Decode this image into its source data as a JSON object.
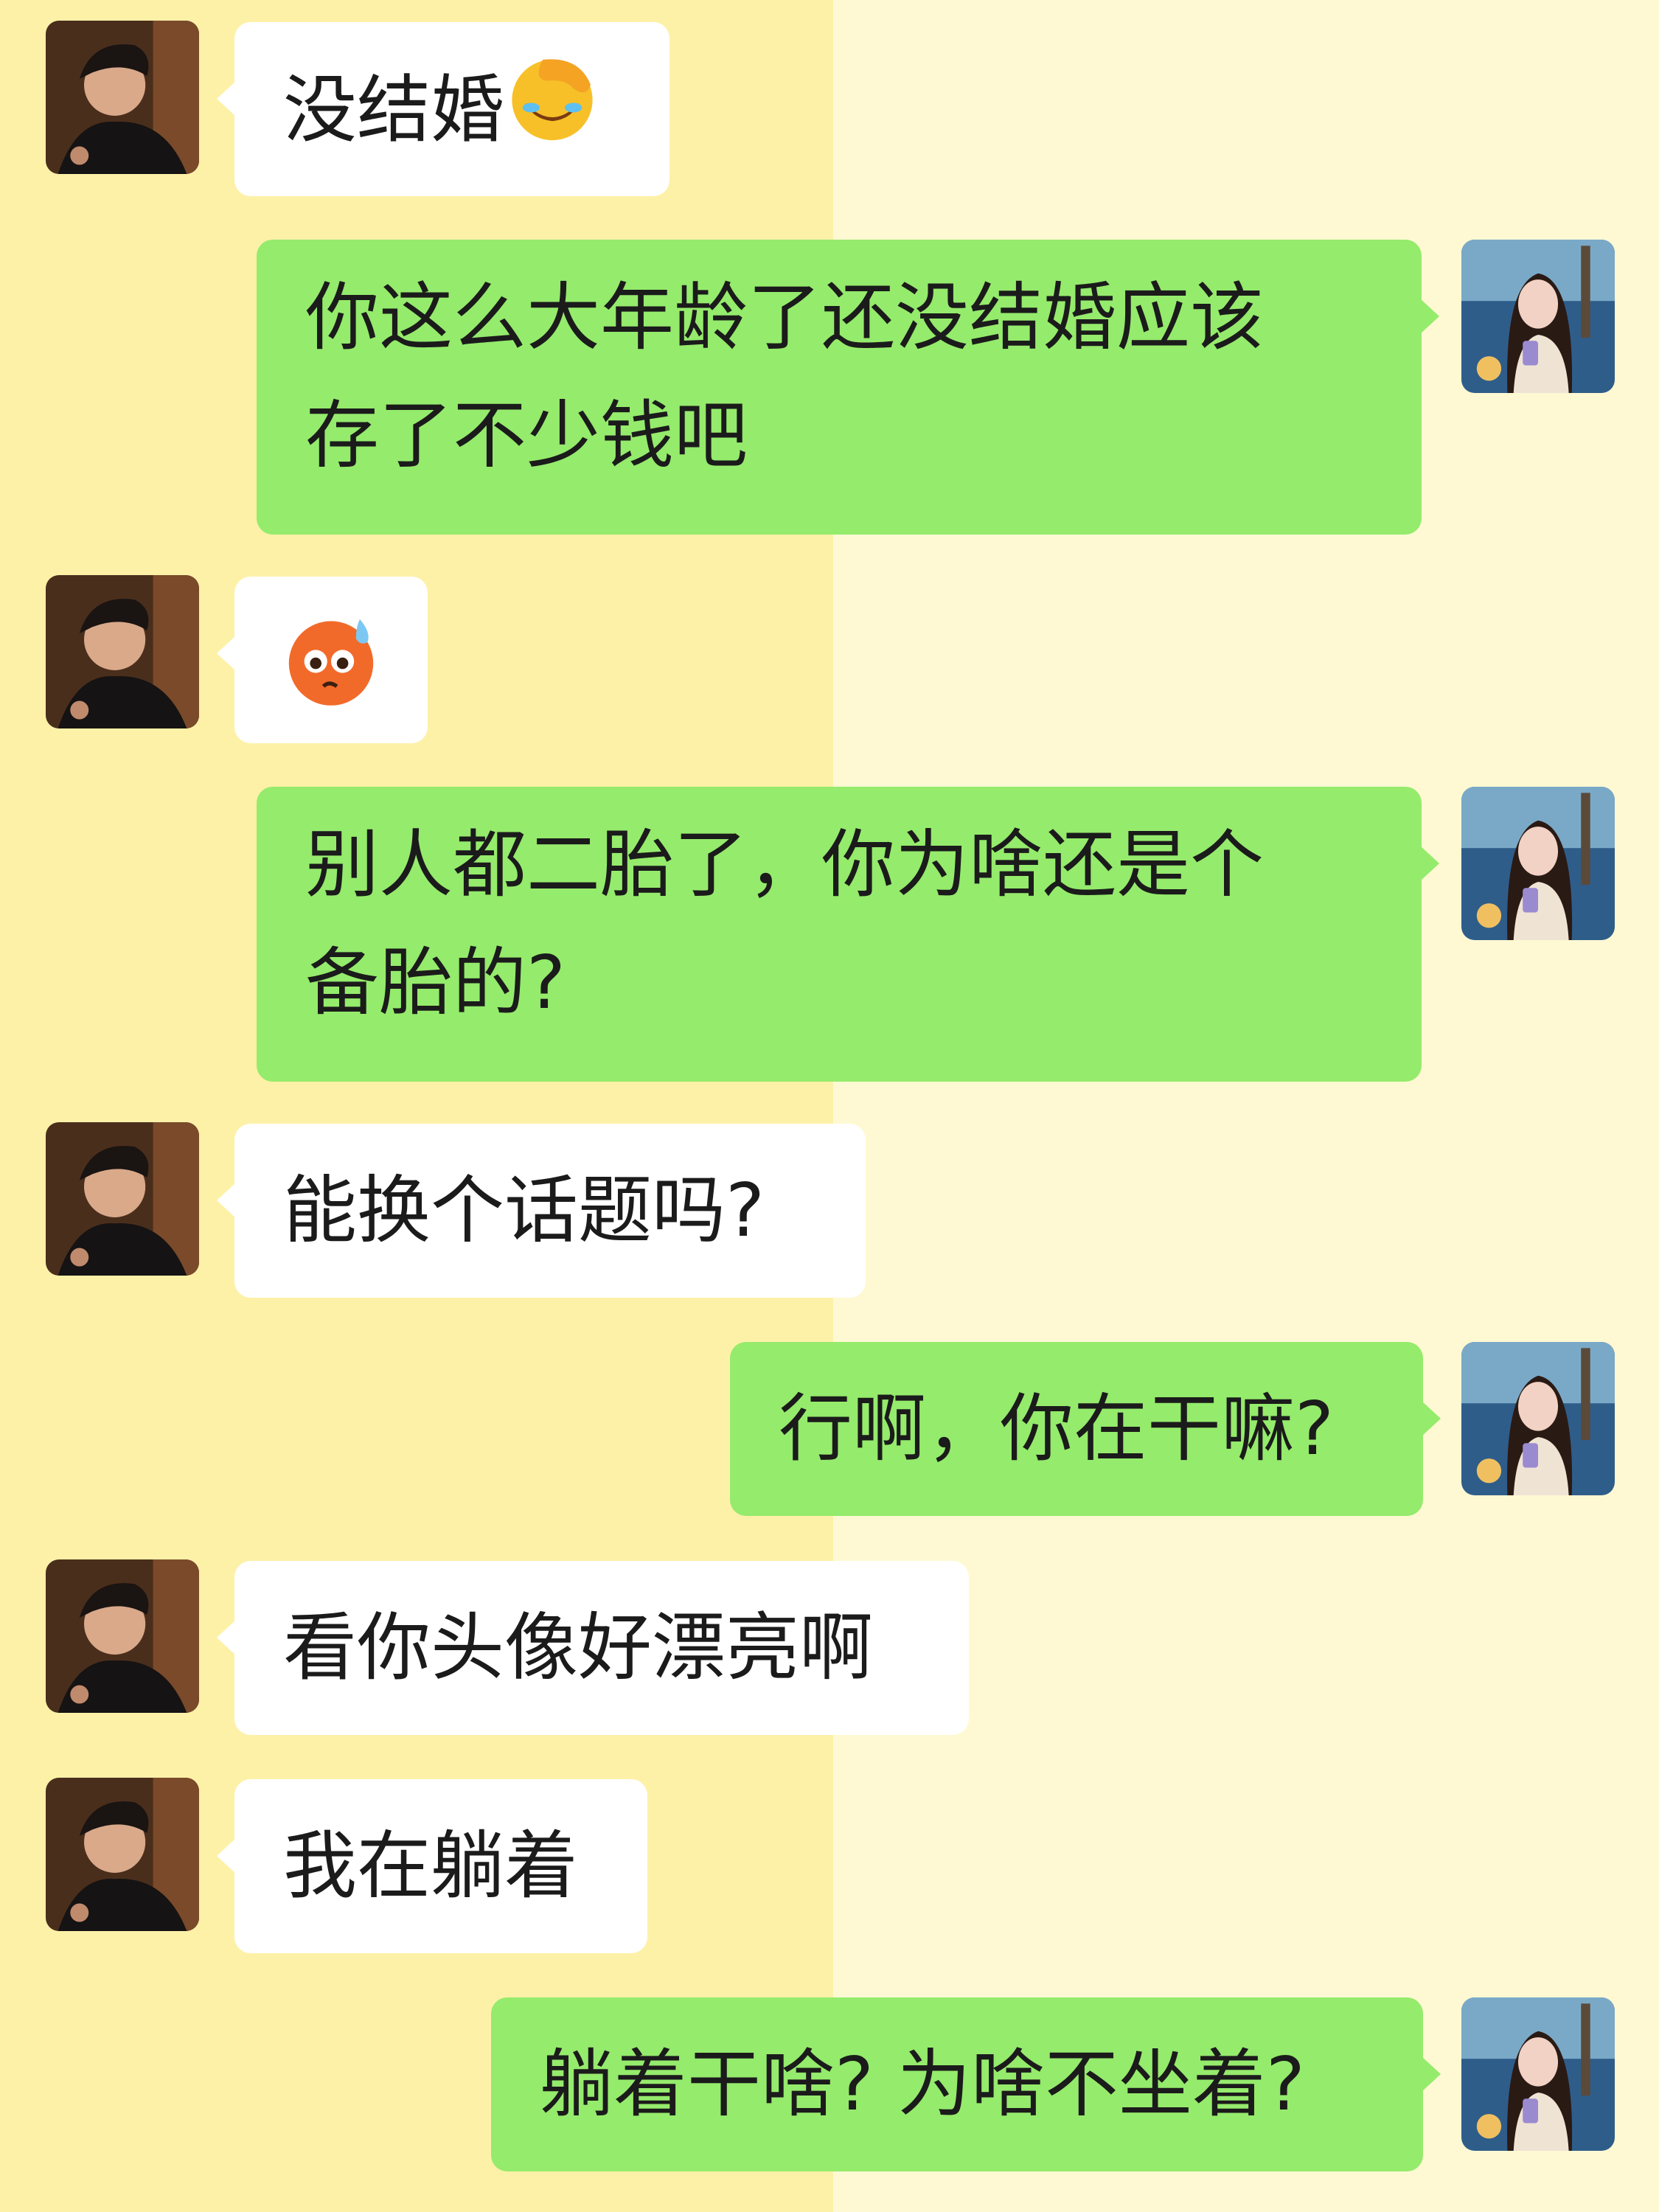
{
  "messages": [
    {
      "sender": "other",
      "text": "没结婚",
      "emoji": "face-palm-laughing-emoji"
    },
    {
      "sender": "self",
      "lines": [
        "你这么大年龄了还没结婚应该",
        "存了不少钱吧"
      ]
    },
    {
      "sender": "other",
      "emoji": "flushed-sweat-emoji"
    },
    {
      "sender": "self",
      "lines": [
        "别人都二胎了，你为啥还是个",
        "备胎的?"
      ]
    },
    {
      "sender": "other",
      "text": "能换个话题吗?"
    },
    {
      "sender": "self",
      "text": "行啊，你在干嘛?"
    },
    {
      "sender": "other",
      "text": "看你头像好漂亮啊"
    },
    {
      "sender": "other",
      "text": "我在躺着"
    },
    {
      "sender": "self",
      "text": "躺着干啥? 为啥不坐着?"
    }
  ],
  "colors": {
    "bg_left": "#fdf1a8",
    "bg_right": "#fef9d3",
    "incoming_bubble": "#ffffff",
    "outgoing_bubble": "#95eb6c"
  }
}
